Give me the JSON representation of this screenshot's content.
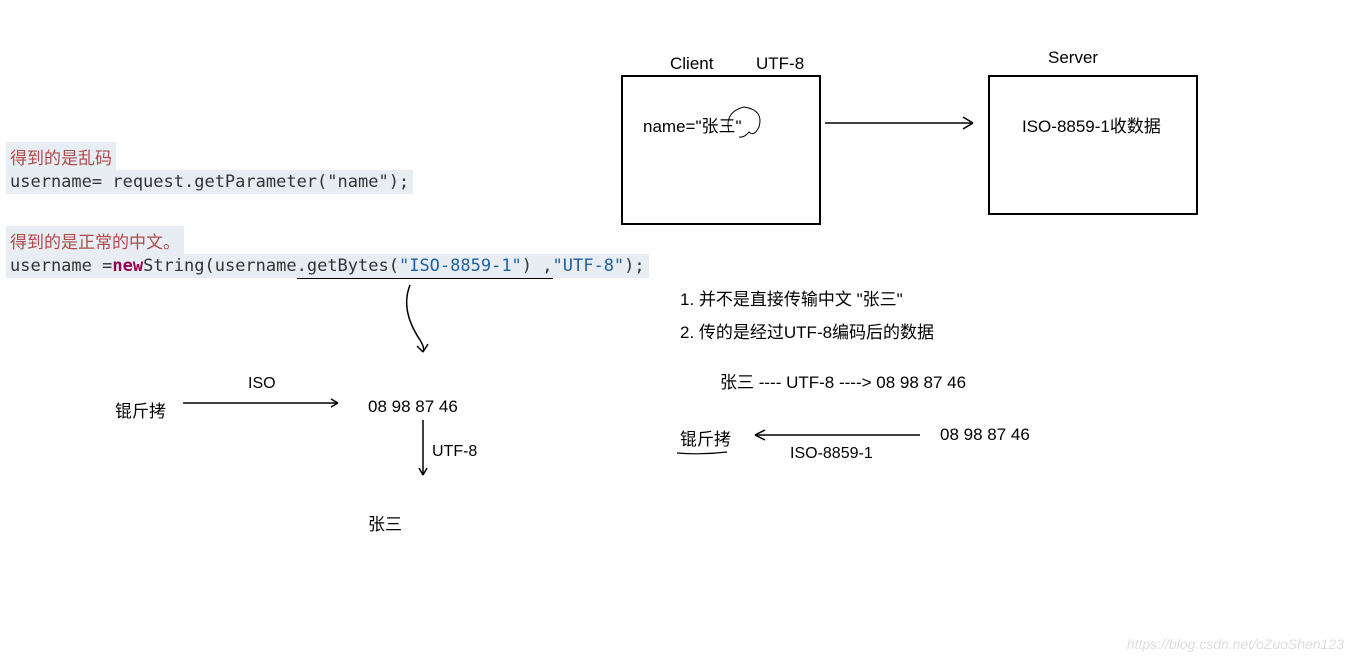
{
  "code_block1": {
    "comment": "得到的是乱码",
    "line": "username= request.getParameter(\"name\");"
  },
  "code_block2": {
    "comment": "得到的是正常的中文。",
    "var": "username = ",
    "kw": "new",
    "after_kw": " String(username",
    "method": ".getBytes(",
    "str1": "\"ISO-8859-1\"",
    "close1": ") , ",
    "str2": "\"UTF-8\"",
    "close2": ");"
  },
  "left_diagram": {
    "garbled": "锟斤拷",
    "iso": "ISO",
    "bytes": "08 98 87 46",
    "utf8": "UTF-8",
    "name": "张三"
  },
  "client": {
    "label": "Client",
    "enc": "UTF-8",
    "content": "name=\"张三\""
  },
  "server": {
    "label": "Server",
    "content": "ISO-8859-1收数据"
  },
  "notes": {
    "line1": "1. 并不是直接传输中文 \"张三\"",
    "line2": "2. 传的是经过UTF-8编码后的数据"
  },
  "right_flow": {
    "name": "张三",
    "arrow_utf8": "  ----  UTF-8  ---->  ",
    "bytes": "08 98  87 46",
    "garbled": "锟斤拷",
    "iso": "ISO-8859-1",
    "bytes2": "08 98  87 46"
  },
  "watermark": "https://blog.csdn.net/oZuoShen123"
}
